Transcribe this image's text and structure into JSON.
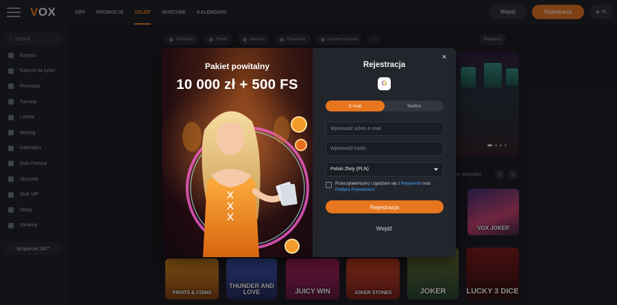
{
  "header": {
    "logo_v": "V",
    "logo_rest": "OX",
    "nav": [
      "GRY",
      "PROMOCJE",
      "SKLEP",
      "SKRZYNIE",
      "KALENDARZ"
    ],
    "login_label": "Wejdź",
    "register_label": "Rejestracja",
    "language": "PL"
  },
  "sidebar": {
    "search_placeholder": "Szukaj",
    "items": [
      "Kasyno",
      "Kasyno na żywo",
      "Promocje",
      "Turnieje",
      "Loterie",
      "Wyścig",
      "Kalendarz",
      "Koło Fortuny",
      "Skrzynie",
      "Klub VIP",
      "Sklep",
      "Ranking"
    ],
    "support_label": "Wsparcie 24/7"
  },
  "filters": {
    "chips": [
      "Wszystko",
      "Forpitt",
      "Nowości",
      "Popularne",
      "Kasyno na żywo",
      "..."
    ],
    "providers_label": "Podawcy"
  },
  "section": {
    "see_all": "oz wszystko"
  },
  "games": {
    "tiles": [
      "FRUITS & COINS",
      "THUNDER AND LOVE",
      "JUICY WIN",
      "JOKER STONES",
      "JOKER",
      "LUCKY 3 DICE"
    ],
    "side_tile": "VOX JOKER"
  },
  "promo": {
    "title": "Pakiet powitalny",
    "amount": "10 000 zł + 500 FS"
  },
  "form": {
    "title": "Rejestracja",
    "google_label": "G",
    "tabs": [
      "E-mail",
      "Telefon"
    ],
    "email_placeholder": "Wprowadź adres e-mail",
    "password_placeholder": "Wprowadź hasło",
    "currency_value": "Polski Złoty (PLN)",
    "consent_prefix": "Przeczytałem(am) i zgadzam się z ",
    "consent_link1": "Regulamin",
    "consent_mid": " oraz ",
    "consent_link2": "Polityka Prywatności",
    "consent_suffix": ".",
    "submit_label": "Rejestracja",
    "login_link": "Wejdź",
    "close_symbol": "×"
  },
  "colors": {
    "accent": "#e7761f",
    "link": "#3ea7ff",
    "modal_bg": "#23252d"
  }
}
